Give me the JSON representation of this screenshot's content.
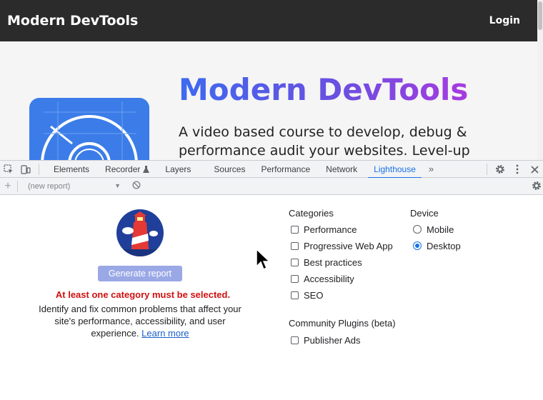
{
  "site": {
    "brand": "Modern DevTools",
    "login": "Login",
    "hero_title": "Modern DevTools",
    "hero_subtitle": "A video based course to develop, debug & performance audit your websites. Level-up"
  },
  "devtools": {
    "tabs": [
      {
        "label": "Elements"
      },
      {
        "label": "Recorder"
      },
      {
        "label": "Layers"
      },
      {
        "label": "Sources"
      },
      {
        "label": "Performance"
      },
      {
        "label": "Network"
      },
      {
        "label": "Lighthouse",
        "active": true
      }
    ],
    "more": "»",
    "report_select": "(new report)"
  },
  "lighthouse": {
    "generate_label": "Generate report",
    "warning": "At least one category must be selected.",
    "description": "Identify and fix common problems that affect your site's performance, accessibility, and user experience.",
    "learn_more": "Learn more",
    "categories_title": "Categories",
    "categories": [
      {
        "label": "Performance",
        "checked": false
      },
      {
        "label": "Progressive Web App",
        "checked": false
      },
      {
        "label": "Best practices",
        "checked": false
      },
      {
        "label": "Accessibility",
        "checked": false
      },
      {
        "label": "SEO",
        "checked": false
      }
    ],
    "device_title": "Device",
    "devices": [
      {
        "label": "Mobile",
        "selected": false
      },
      {
        "label": "Desktop",
        "selected": true
      }
    ],
    "plugins_title": "Community Plugins (beta)",
    "plugins": [
      {
        "label": "Publisher Ads",
        "checked": false
      }
    ]
  },
  "colors": {
    "accent": "#1a73e8",
    "warning": "#d01010",
    "header_bg": "#2b2b2b",
    "hero_blue": "#3b7ce8"
  }
}
